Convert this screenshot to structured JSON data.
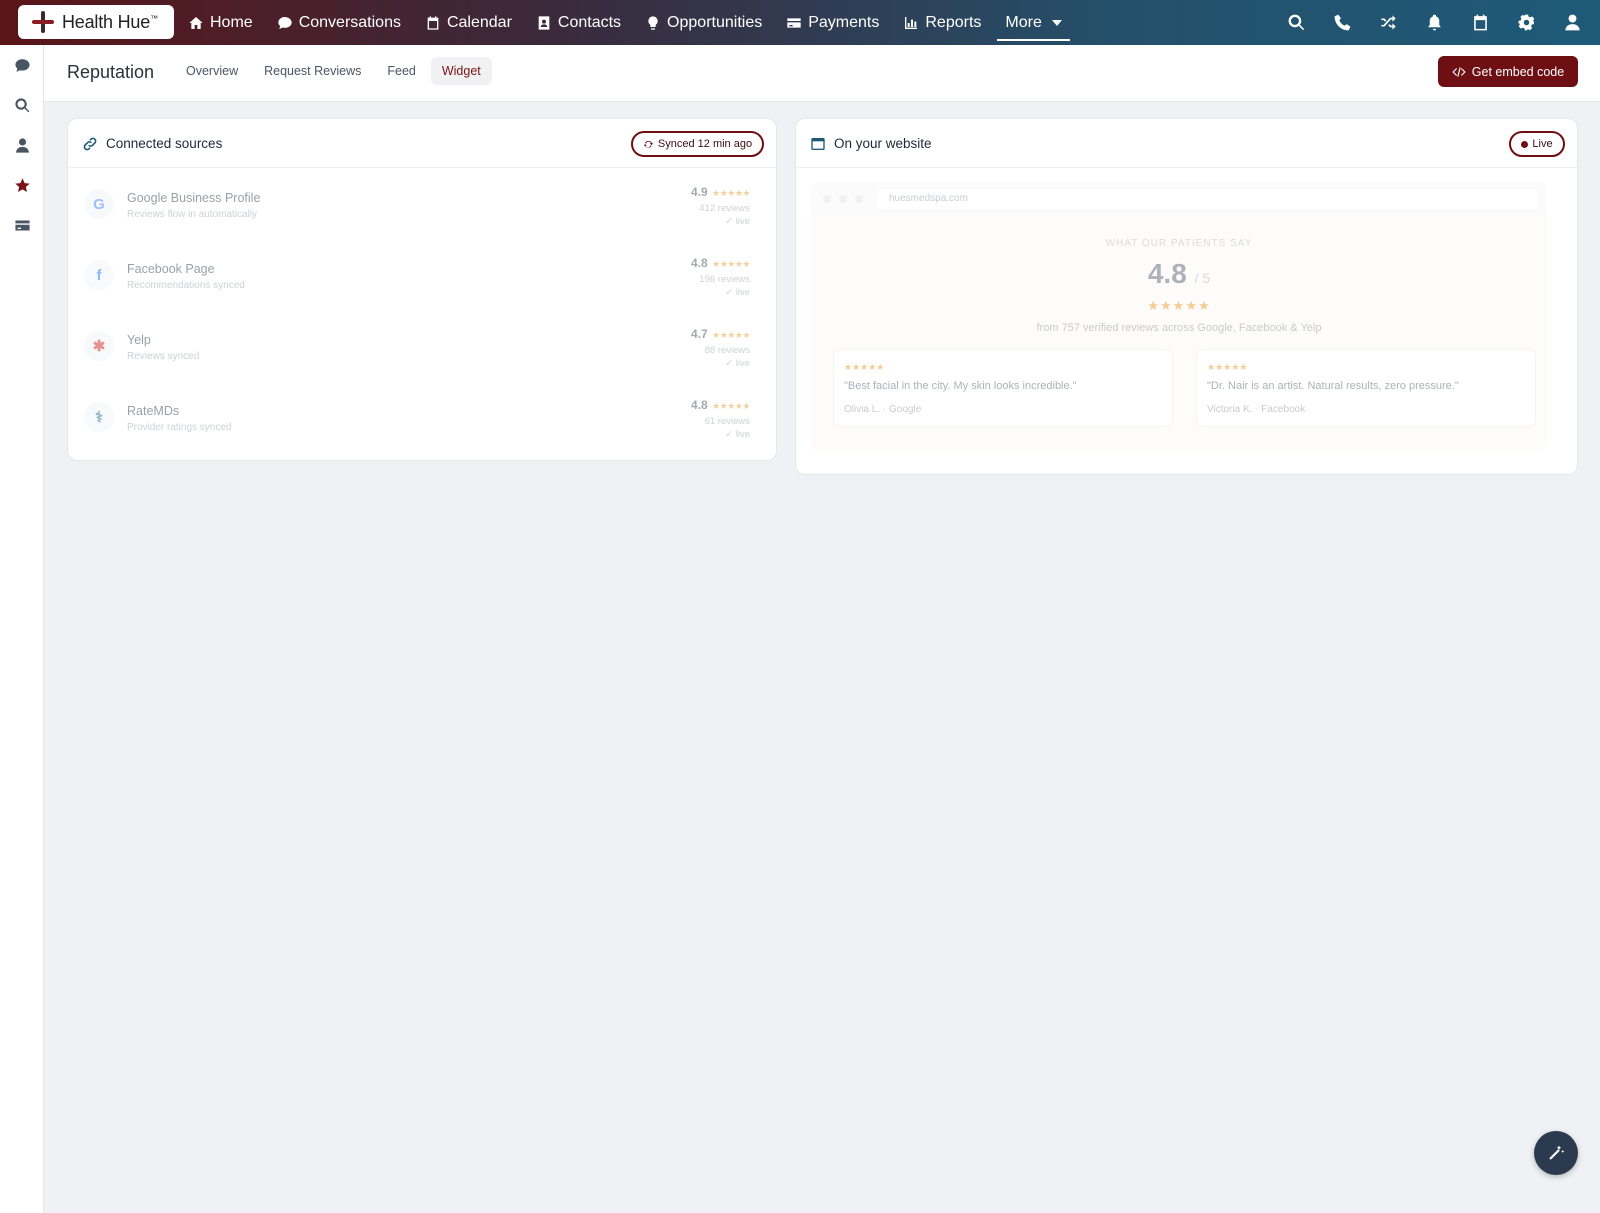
{
  "brand": {
    "name": "Health Hue",
    "mark": "™"
  },
  "nav": {
    "items": [
      {
        "label": "Home",
        "icon": "home-icon"
      },
      {
        "label": "Conversations",
        "icon": "chat-icon"
      },
      {
        "label": "Calendar",
        "icon": "calendar-icon"
      },
      {
        "label": "Contacts",
        "icon": "contact-card-icon"
      },
      {
        "label": "Opportunities",
        "icon": "lightbulb-icon"
      },
      {
        "label": "Payments",
        "icon": "credit-card-icon"
      },
      {
        "label": "Reports",
        "icon": "bar-chart-icon"
      },
      {
        "label": "More",
        "icon": "chevron-down-icon"
      }
    ],
    "right_icons": [
      "search-icon",
      "phone-icon",
      "shuffle-icon",
      "bell-icon",
      "calendar-icon",
      "gear-icon",
      "user-icon"
    ]
  },
  "sidebar": {
    "icons": [
      "chat-icon",
      "search-icon",
      "user-icon",
      "star-icon",
      "credit-card-icon"
    ],
    "active": "star-icon"
  },
  "page": {
    "title": "Reputation",
    "tabs": [
      "Overview",
      "Request Reviews",
      "Feed",
      "Widget"
    ],
    "active_tab": "Widget",
    "embed_button": "Get embed code"
  },
  "sources_card": {
    "title": "Connected sources",
    "sync_status": "Synced 12 min ago",
    "sources": [
      {
        "name": "Google Business Profile",
        "sub": "Reviews flow in automatically",
        "rating": "4.9",
        "stars": "★★★★★",
        "reviews": "412 reviews",
        "status": "✓ live",
        "glyph": "G",
        "color": "#4285f4"
      },
      {
        "name": "Facebook Page",
        "sub": "Recommendations synced",
        "rating": "4.8",
        "stars": "★★★★★",
        "reviews": "196 reviews",
        "status": "✓ live",
        "glyph": "f",
        "color": "#1877f2"
      },
      {
        "name": "Yelp",
        "sub": "Reviews synced",
        "rating": "4.7",
        "stars": "★★★★★",
        "reviews": "88 reviews",
        "status": "✓ live",
        "glyph": "✱",
        "color": "#d32323"
      },
      {
        "name": "RateMDs",
        "sub": "Provider ratings synced",
        "rating": "4.8",
        "stars": "★★★★★",
        "reviews": "61 reviews",
        "status": "✓ live",
        "glyph": "⚕",
        "color": "#2f6f8f"
      }
    ]
  },
  "website_card": {
    "title": "On your website",
    "status": "Live",
    "url": "huesmedspa.com",
    "heading": "WHAT OUR PATIENTS SAY",
    "score": "4.8",
    "score_suffix": "/ 5",
    "stars": "★★★★★",
    "summary": "from 757 verified reviews across Google, Facebook & Yelp",
    "quotes": [
      {
        "stars": "★★★★★",
        "text": "\"Best facial in the city. My skin looks incredible.\"",
        "author": "Olivia L. · Google"
      },
      {
        "stars": "★★★★★",
        "text": "\"Dr. Nair is an artist. Natural results, zero pressure.\"",
        "author": "Victoria K. · Facebook"
      }
    ]
  },
  "colors": {
    "accent": "#6d0f13",
    "star": "#e8a43a"
  },
  "fab_icon": "magic-wand-icon"
}
